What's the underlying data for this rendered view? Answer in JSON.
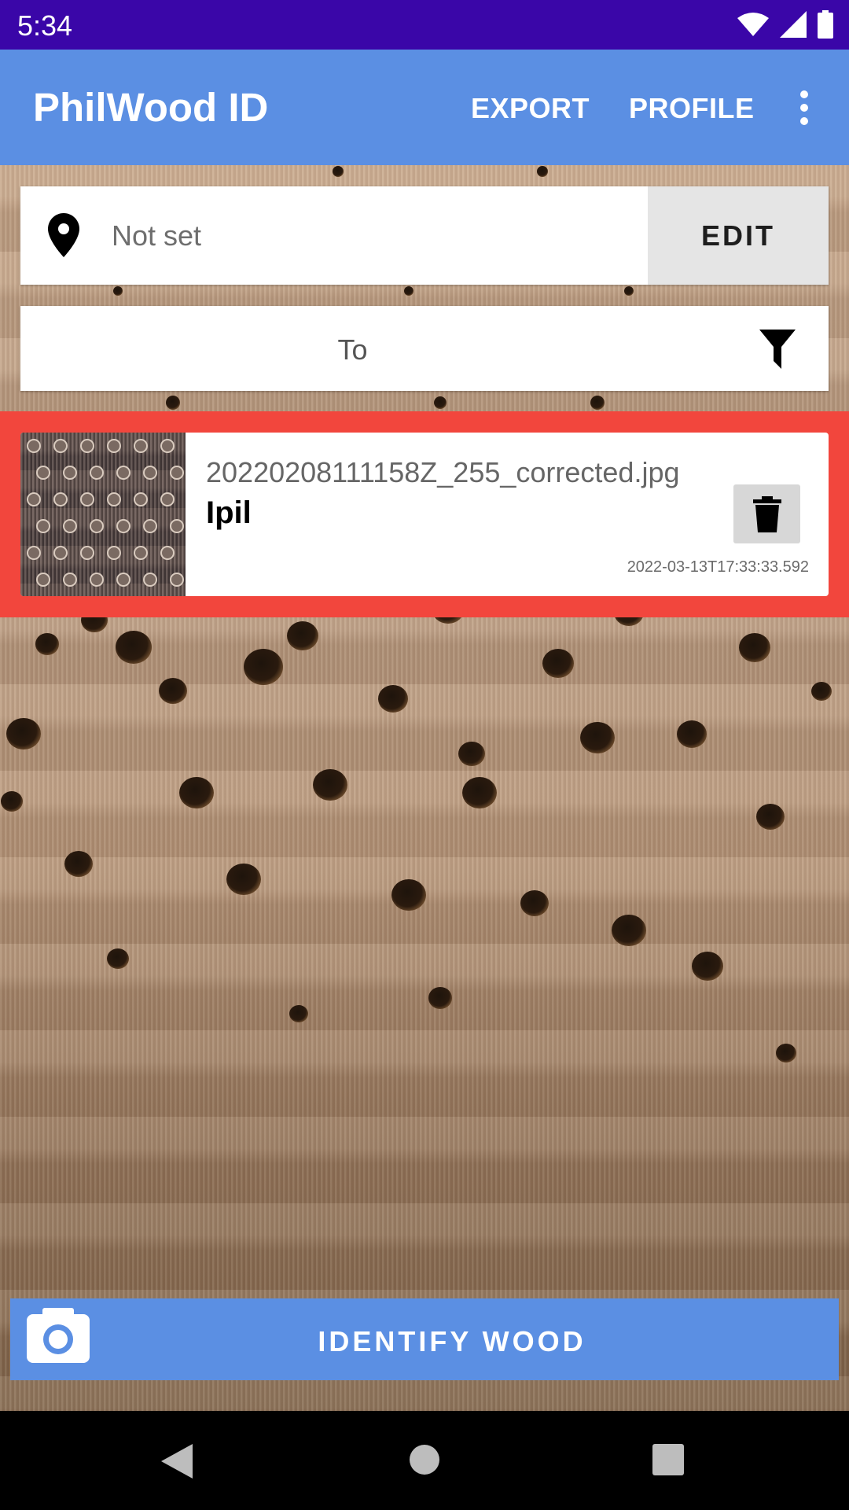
{
  "status_bar": {
    "time": "5:34"
  },
  "app_bar": {
    "title": "PhilWood ID",
    "actions": {
      "export": "EXPORT",
      "profile": "PROFILE"
    }
  },
  "location": {
    "value": "Not set",
    "edit_label": "EDIT"
  },
  "filter": {
    "text": "To"
  },
  "entries": [
    {
      "filename": "20220208111158Z_255_corrected.jpg",
      "species": "Ipil",
      "timestamp": "2022-03-13T17:33:33.592",
      "selected": true
    }
  ],
  "identify_button": {
    "label": "IDENTIFY WOOD"
  },
  "colors": {
    "status_bar": "#3a06a8",
    "app_bar": "#5b8fe3",
    "selection": "#f2463d"
  },
  "icons": {
    "location": "map-pin-icon",
    "filter": "filter-icon",
    "delete": "trash-icon",
    "camera": "camera-icon",
    "more": "more-vert-icon"
  }
}
